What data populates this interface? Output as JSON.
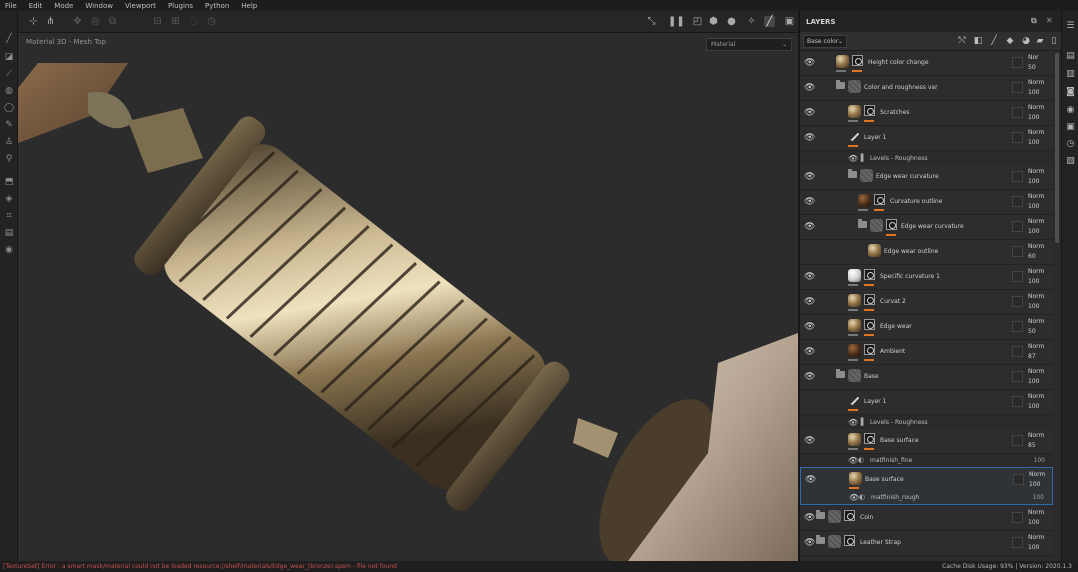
{
  "menu": [
    "File",
    "Edit",
    "Mode",
    "Window",
    "Viewport",
    "Plugins",
    "Python",
    "Help"
  ],
  "viewport": {
    "label": "Material 3D - Mesh Top",
    "channel_select": "Material"
  },
  "layers_panel": {
    "title": "LAYERS",
    "channel": "Base color",
    "rows": [
      {
        "name": "Height color change",
        "blend": "Nor",
        "opacity": "50"
      },
      {
        "name": "Color and roughness var",
        "blend": "Norm",
        "opacity": "100"
      },
      {
        "name": "Scratches",
        "blend": "Norm",
        "opacity": "100"
      },
      {
        "name": "Layer 1",
        "blend": "Norm",
        "opacity": "100"
      },
      {
        "name": "Levels - Roughness",
        "sub": true
      },
      {
        "name": "Edge wear curvature",
        "blend": "Norm",
        "opacity": "100"
      },
      {
        "name": "Curvature outline",
        "blend": "Norm",
        "opacity": "100"
      },
      {
        "name": "Edge wear curvature",
        "blend": "Norm",
        "opacity": "100"
      },
      {
        "name": "Edge wear outline",
        "blend": "Norm",
        "opacity": "60"
      },
      {
        "name": "Specific curvature 1",
        "blend": "Norm",
        "opacity": "100"
      },
      {
        "name": "Curvat 2",
        "blend": "Norm",
        "opacity": "100"
      },
      {
        "name": "Edge wear",
        "blend": "Norm",
        "opacity": "50"
      },
      {
        "name": "Ambient",
        "blend": "Norm",
        "opacity": "87"
      },
      {
        "name": "Base",
        "blend": "Norm",
        "opacity": "100"
      },
      {
        "name": "Layer 1",
        "blend": "Norm",
        "opacity": "100"
      },
      {
        "name": "Levels - Roughness",
        "sub": true
      },
      {
        "name": "Base surface",
        "blend": "Norm",
        "opacity": "85"
      },
      {
        "name": "matfinish_fine",
        "sub": true,
        "value": "100"
      },
      {
        "name": "Base surface",
        "blend": "Norm",
        "opacity": "100"
      },
      {
        "name": "matfinish_rough",
        "sub": true,
        "value": "100"
      },
      {
        "name": "Coin",
        "blend": "Norm",
        "opacity": "100"
      },
      {
        "name": "Leather Strap",
        "blend": "Norm",
        "opacity": "100"
      }
    ]
  },
  "status": {
    "left": "[TextureSet] Error : a smart mask/material could not be loaded resource://shelf/materials/Edge_wear_(bronze).spsm - file not found",
    "right": "Cache Disk Usage: 93% | Version: 2020.1.3"
  }
}
